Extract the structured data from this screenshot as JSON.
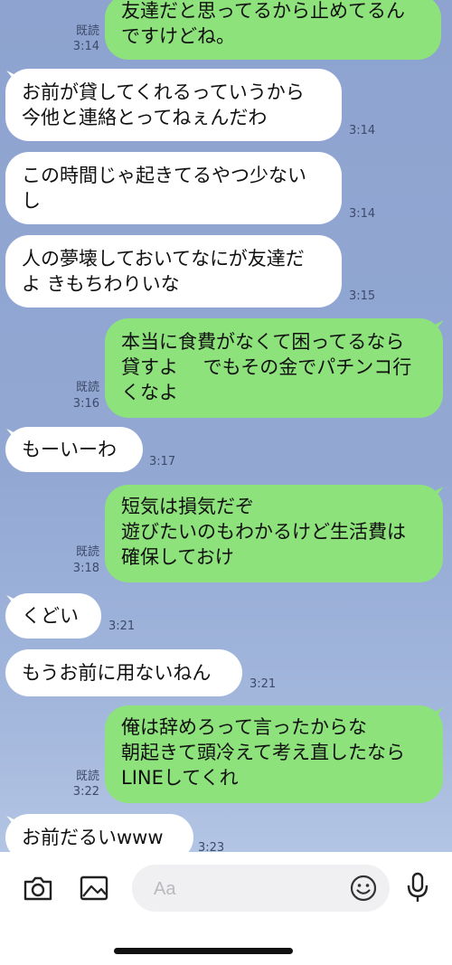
{
  "messages": [
    {
      "side": "out",
      "text": "友達だと思ってるから止めてるん\nですけどね。",
      "read": "既読",
      "time": "3:14"
    },
    {
      "side": "in",
      "text": "お前が貸してくれるっていうから\n今他と連絡とってねぇんだわ",
      "time": "3:14"
    },
    {
      "side": "in",
      "text": "この時間じゃ起きてるやつ少ない\nし",
      "time": "3:14"
    },
    {
      "side": "in",
      "text": "人の夢壊しておいてなにが友達だ\nよ きもちわりいな",
      "time": "3:15"
    },
    {
      "side": "out",
      "text": "本当に食費がなくて困ってるなら\n貸すよ　 でもその金でパチンコ行\nくなよ",
      "read": "既読",
      "time": "3:16"
    },
    {
      "side": "in",
      "text": "もーいーわ",
      "time": "3:17"
    },
    {
      "side": "out",
      "text": "短気は損気だぞ\n遊びたいのもわかるけど生活費は\n確保しておけ",
      "read": "既読",
      "time": "3:18"
    },
    {
      "side": "in",
      "text": "くどい",
      "time": "3:21"
    },
    {
      "side": "in",
      "text": "もうお前に用ないねん",
      "time": "3:21"
    },
    {
      "side": "out",
      "text": "俺は辞めろって言ったからな\n朝起きて頭冷えて考え直したなら\nLINEしてくれ",
      "read": "既読",
      "time": "3:22"
    },
    {
      "side": "in",
      "text": "お前だるいwww",
      "time": "3:23"
    }
  ],
  "input": {
    "placeholder": "Aa"
  },
  "icons": {
    "camera": "camera-icon",
    "image": "image-icon",
    "emoji": "emoji-icon",
    "mic": "microphone-icon",
    "more": "chevron-right-icon"
  }
}
